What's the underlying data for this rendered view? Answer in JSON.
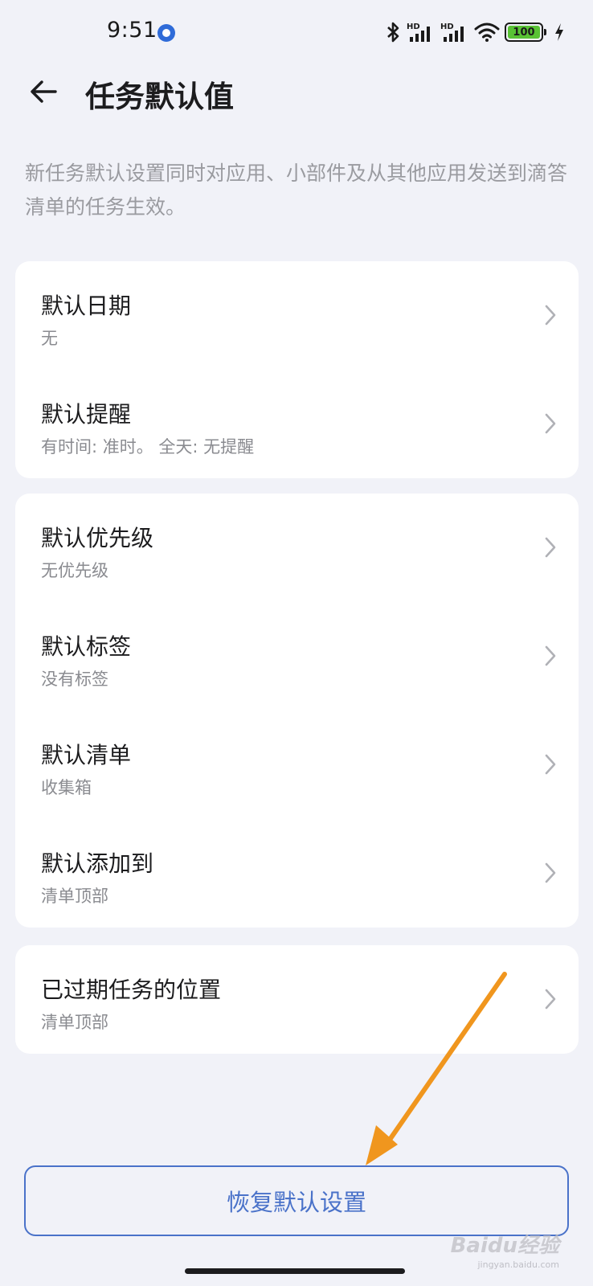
{
  "status_bar": {
    "time": "9:51",
    "icons": [
      "bluetooth-icon",
      "signal-hd-icon",
      "signal-hd-icon",
      "wifi-icon",
      "battery-icon",
      "charging-icon"
    ],
    "battery_level": "100",
    "hd_label": "HD"
  },
  "header": {
    "title": "任务默认值"
  },
  "description": "新任务默认设置同时对应用、小部件及从其他应用发送到滴答清单的任务生效。",
  "groups": [
    {
      "items": [
        {
          "title": "默认日期",
          "value": "无"
        },
        {
          "title": "默认提醒",
          "value": "有时间: 准时。 全天: 无提醒"
        }
      ]
    },
    {
      "items": [
        {
          "title": "默认优先级",
          "value": "无优先级"
        },
        {
          "title": "默认标签",
          "value": "没有标签"
        },
        {
          "title": "默认清单",
          "value": "收集箱"
        },
        {
          "title": "默认添加到",
          "value": "清单顶部"
        }
      ]
    },
    {
      "items": [
        {
          "title": "已过期任务的位置",
          "value": "清单顶部"
        }
      ]
    }
  ],
  "restore_button": "恢复默认设置",
  "watermark": {
    "brand": "Baidu经验",
    "url": "jingyan.baidu.com"
  },
  "colors": {
    "background": "#f1f2f8",
    "card": "#ffffff",
    "accent": "#4a72c9",
    "annotation_arrow": "#f0961e",
    "battery": "#59c234"
  }
}
